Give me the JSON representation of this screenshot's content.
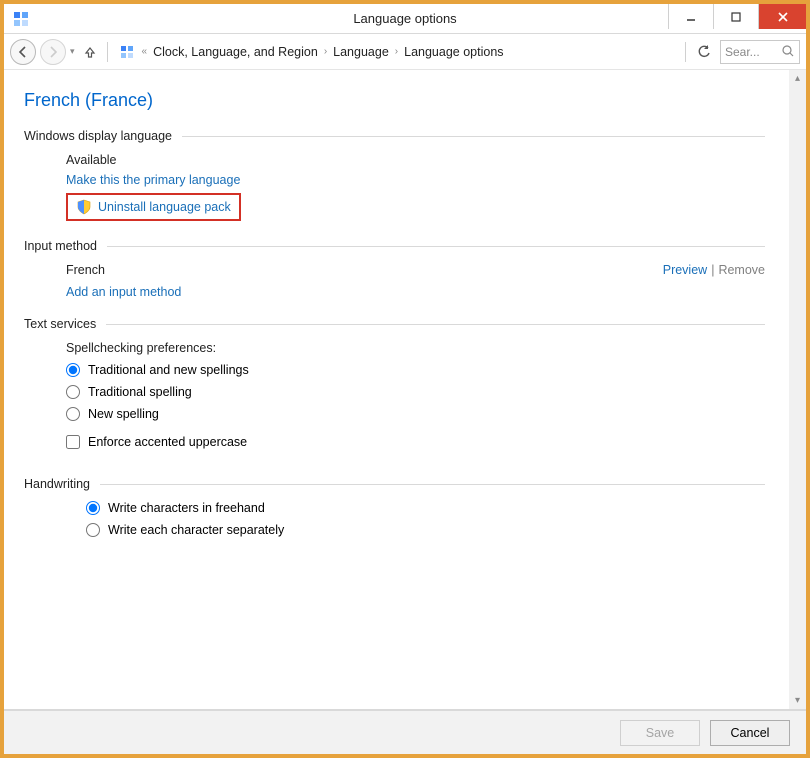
{
  "window": {
    "title": "Language options"
  },
  "breadcrumb": {
    "root_hint": "«",
    "items": [
      "Clock, Language, and Region",
      "Language",
      "Language options"
    ]
  },
  "search": {
    "placeholder": "Sear..."
  },
  "page": {
    "title": "French (France)"
  },
  "sections": {
    "display_language": {
      "header": "Windows display language",
      "status": "Available",
      "make_primary": "Make this the primary language",
      "uninstall": "Uninstall language pack"
    },
    "input_method": {
      "header": "Input method",
      "item_name": "French",
      "preview": "Preview",
      "remove": "Remove",
      "add": "Add an input method"
    },
    "text_services": {
      "header": "Text services",
      "spell_label": "Spellchecking preferences:",
      "opt_trad_new": "Traditional and new spellings",
      "opt_trad": "Traditional spelling",
      "opt_new": "New spelling",
      "enforce_accented": "Enforce accented uppercase"
    },
    "handwriting": {
      "header": "Handwriting",
      "opt_freehand": "Write characters in freehand",
      "opt_separate": "Write each character separately"
    }
  },
  "footer": {
    "save": "Save",
    "cancel": "Cancel"
  }
}
